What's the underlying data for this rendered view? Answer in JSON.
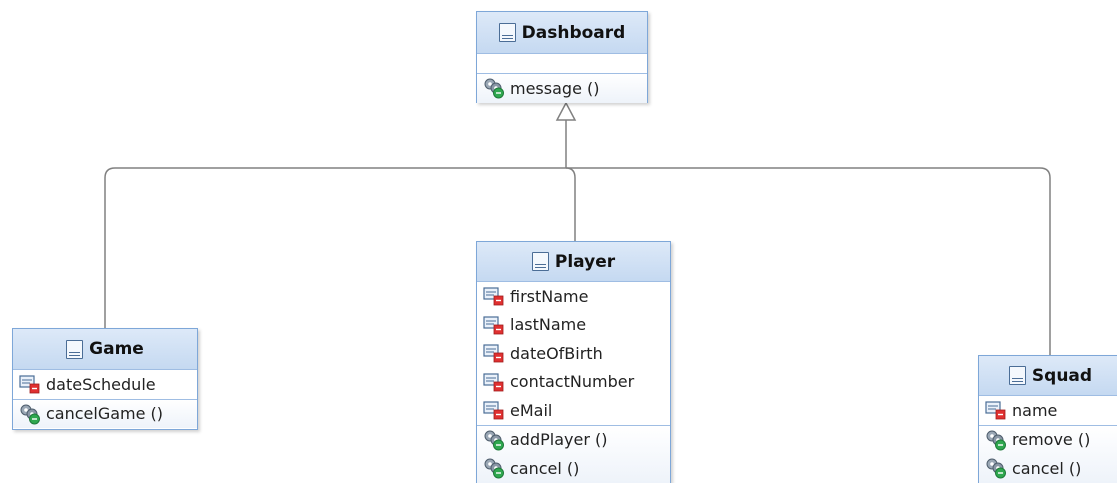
{
  "classes": {
    "dashboard": {
      "name": "Dashboard",
      "attributes": [],
      "operations": [
        "message ()"
      ]
    },
    "game": {
      "name": "Game",
      "attributes": [
        "dateSchedule"
      ],
      "operations": [
        "cancelGame ()"
      ]
    },
    "player": {
      "name": "Player",
      "attributes": [
        "firstName",
        "lastName",
        "dateOfBirth",
        "contactNumber",
        "eMail"
      ],
      "operations": [
        "addPlayer ()",
        "cancel ()"
      ]
    },
    "squad": {
      "name": "Squad",
      "attributes": [
        "name"
      ],
      "operations": [
        "remove ()",
        "cancel ()"
      ]
    }
  },
  "relationships": [
    {
      "type": "generalization",
      "from": "Game",
      "to": "Dashboard"
    },
    {
      "type": "generalization",
      "from": "Player",
      "to": "Dashboard"
    },
    {
      "type": "generalization",
      "from": "Squad",
      "to": "Dashboard"
    }
  ],
  "colors": {
    "header_top": "#dde9f8",
    "header_bottom": "#c5d9f1",
    "border": "#7ea7d8",
    "edge": "#808080",
    "attribute_marker": "#e03030",
    "operation_marker": "#2fa84f"
  },
  "icons": {
    "class": "class-icon",
    "attribute": "private-attribute-icon",
    "operation": "public-operation-icon"
  }
}
